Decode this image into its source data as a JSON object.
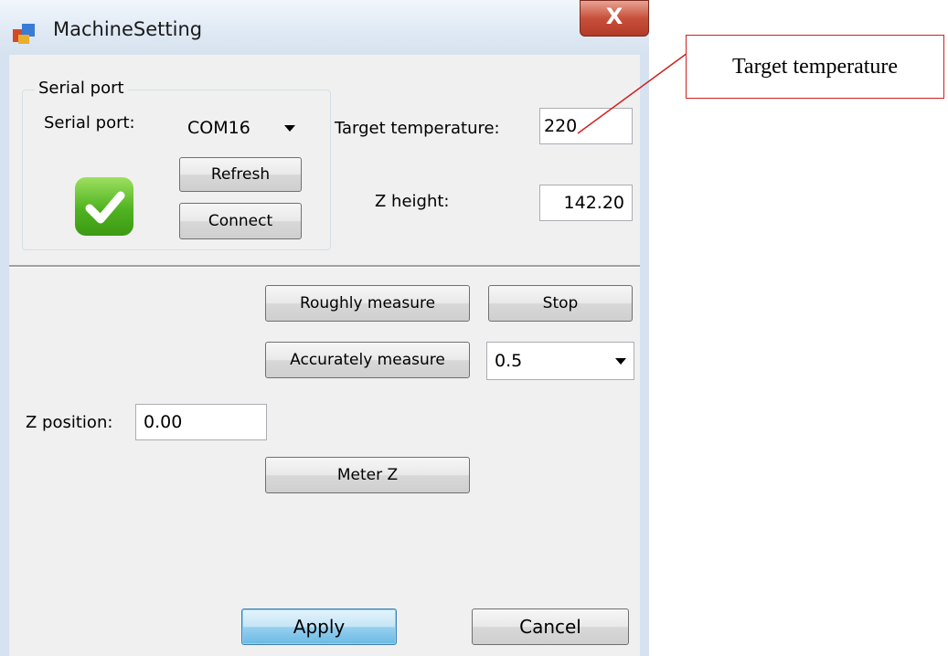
{
  "window": {
    "title": "MachineSetting",
    "close_glyph": "X"
  },
  "serial_group": {
    "legend": "Serial port",
    "port_label": "Serial port:",
    "port_value": "COM16",
    "refresh_label": "Refresh",
    "connect_label": "Connect",
    "status_icon": "check-icon"
  },
  "temperature": {
    "label": "Target temperature:",
    "value": "220"
  },
  "z_height": {
    "label": "Z height:",
    "value": "142.20"
  },
  "measure": {
    "roughly_label": "Roughly measure",
    "stop_label": "Stop",
    "accurately_label": "Accurately measure",
    "step_value": "0.5"
  },
  "z_position": {
    "label": "Z position:",
    "value": "0.00"
  },
  "meter_z_label": "Meter Z",
  "dialog": {
    "apply_label": "Apply",
    "cancel_label": "Cancel"
  },
  "annotation": {
    "text": "Target temperature",
    "color": "#d02020"
  }
}
